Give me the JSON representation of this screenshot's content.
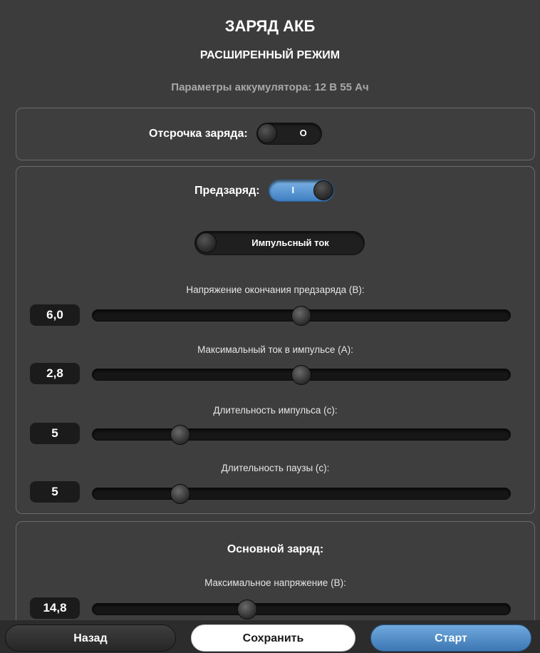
{
  "header": {
    "title": "ЗАРЯД АКБ",
    "subtitle": "РАСШИРЕННЫЙ РЕЖИМ",
    "params": "Параметры аккумулятора: 12 В 55 Ач"
  },
  "delay": {
    "label": "Отсрочка заряда:",
    "toggle_text": "O",
    "enabled": false
  },
  "precharge": {
    "label": "Предзаряд:",
    "toggle_text": "I",
    "enabled": true,
    "pulse_label": "Импульсный ток",
    "pulse_enabled": false,
    "sliders": [
      {
        "label": "Напряжение окончания предзаряда (В):",
        "value": "6,0",
        "level": 0.5
      },
      {
        "label": "Максимальный ток в импульсе (А):",
        "value": "2,8",
        "level": 0.5
      },
      {
        "label": "Длительность импульса (с):",
        "value": "5",
        "level": 0.21
      },
      {
        "label": "Длительность паузы (с):",
        "value": "5",
        "level": 0.21
      }
    ]
  },
  "main_charge": {
    "label": "Основной заряд:",
    "sliders": [
      {
        "label": "Максимальное напряжение (В):",
        "value": "14,8",
        "level": 0.37
      }
    ]
  },
  "footer": {
    "back": "Назад",
    "save": "Сохранить",
    "start": "Старт"
  },
  "colors": {
    "background": "#3c3c3c",
    "accent": "#4a86c5",
    "muted_text": "#a8a8a8"
  }
}
